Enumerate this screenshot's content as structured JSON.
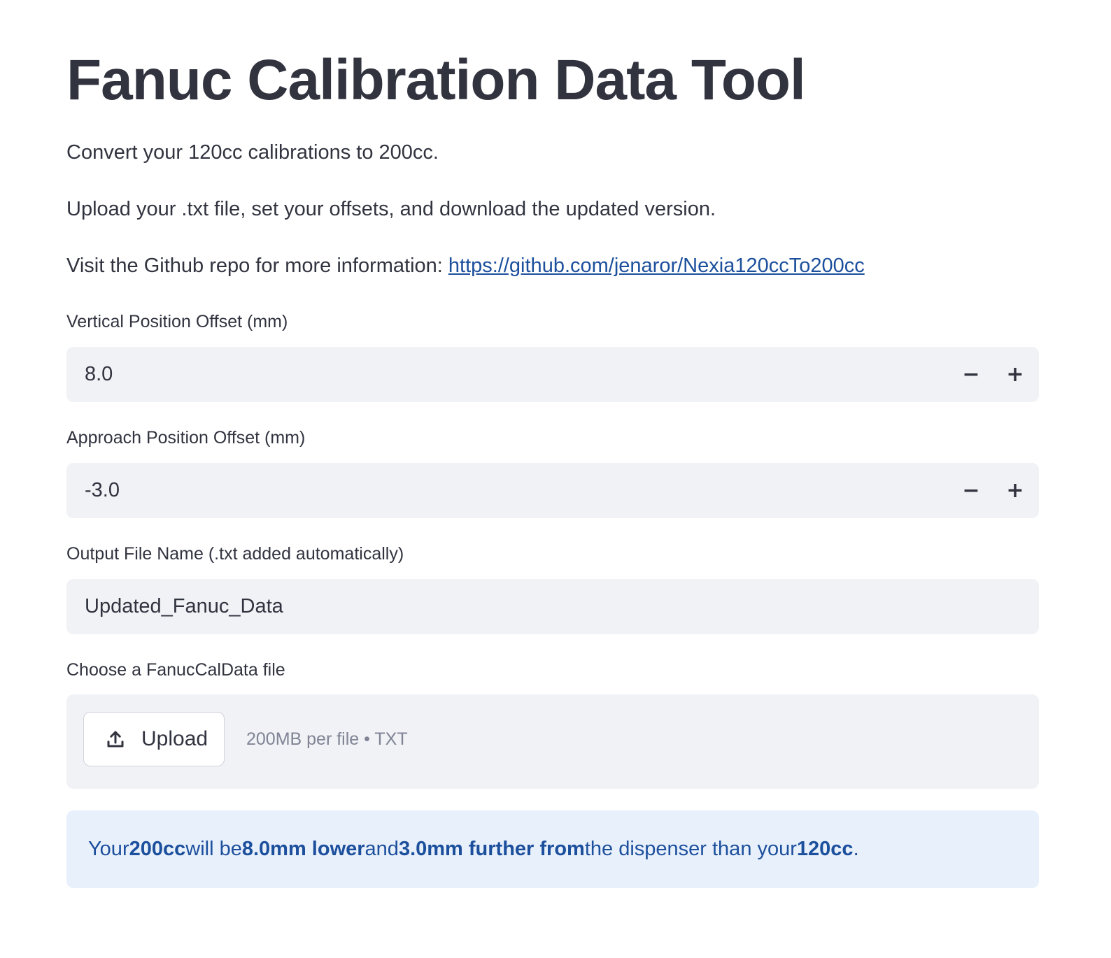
{
  "page": {
    "title": "Fanuc Calibration Data Tool",
    "intro_line_1": "Convert your 120cc calibrations to 200cc.",
    "intro_line_2": "Upload your .txt file, set your offsets, and download the updated version.",
    "repo_prefix": "Visit the Github repo for more information: ",
    "repo_link": "https://github.com/jenaror/Nexia120ccTo200cc"
  },
  "vertical_offset": {
    "label": "Vertical Position Offset (mm)",
    "value": "8.0",
    "minus_label": "−",
    "plus_label": "+"
  },
  "approach_offset": {
    "label": "Approach Position Offset (mm)",
    "value": "-3.0",
    "minus_label": "−",
    "plus_label": "+"
  },
  "output_file": {
    "label": "Output File Name (.txt added automatically)",
    "value": "Updated_Fanuc_Data"
  },
  "file_upload": {
    "label": "Choose a FanucCalData file",
    "button_label": "Upload",
    "button_icon": "upload-icon",
    "hint": "200MB per file • TXT"
  },
  "info": {
    "part_1": "Your ",
    "bold_1": "200cc",
    "part_2": " will be ",
    "bold_2": "8.0mm lower",
    "part_3": " and ",
    "bold_3": "3.0mm further from",
    "part_4": " the dispenser than your ",
    "bold_4": "120cc",
    "part_5": "."
  },
  "colors": {
    "text": "#31333f",
    "link": "#1c4f9c",
    "input_bg": "#f0f2f6",
    "info_bg": "#e8f0fc",
    "info_text": "#1c4f9c",
    "hint_text": "#808495"
  }
}
